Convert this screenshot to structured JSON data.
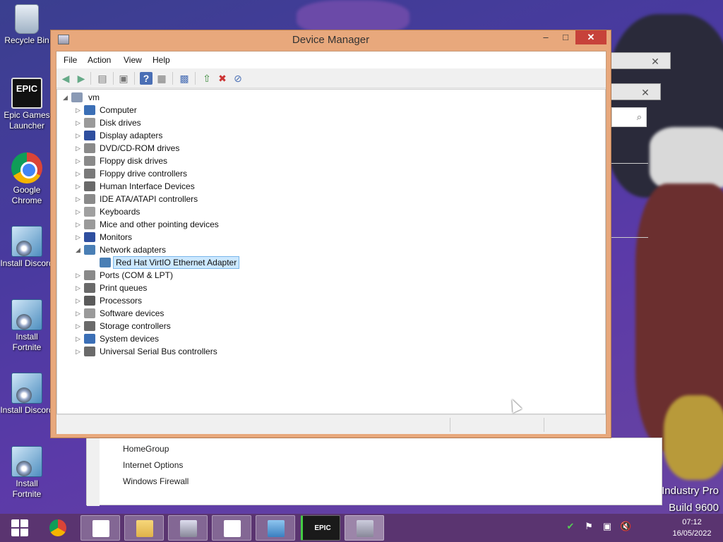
{
  "desktop": {
    "icons": [
      {
        "label": "Recycle Bin"
      },
      {
        "label": "Epic Games Launcher",
        "glyph": "EPIC"
      },
      {
        "label": "Google Chrome"
      },
      {
        "label": "Install Discord"
      },
      {
        "label": "Install Fortnite"
      },
      {
        "label": "Install Discord"
      },
      {
        "label": "Install Fortnite"
      }
    ]
  },
  "background_window": {
    "links": [
      "HomeGroup",
      "Internet Options",
      "Windows Firewall"
    ],
    "close_glyph": "✕",
    "search_glyph": "⌕"
  },
  "window": {
    "title": "Device Manager",
    "minimize_glyph": "–",
    "maximize_glyph": "□",
    "close_glyph": "✕",
    "menu": [
      "File",
      "Action",
      "View",
      "Help"
    ],
    "tree": {
      "root": "vm",
      "categories": [
        {
          "label": "Computer",
          "icon": "computer-icon",
          "color": "#3b6fb6"
        },
        {
          "label": "Disk drives",
          "icon": "disk-icon",
          "color": "#9a9a9a"
        },
        {
          "label": "Display adapters",
          "icon": "display-icon",
          "color": "#2f4f9f"
        },
        {
          "label": "DVD/CD-ROM drives",
          "icon": "dvd-icon",
          "color": "#8a8a8a"
        },
        {
          "label": "Floppy disk drives",
          "icon": "floppy-icon",
          "color": "#8a8a8a"
        },
        {
          "label": "Floppy drive controllers",
          "icon": "floppy-controller-icon",
          "color": "#7a7a7a"
        },
        {
          "label": "Human Interface Devices",
          "icon": "hid-icon",
          "color": "#6a6a6a"
        },
        {
          "label": "IDE ATA/ATAPI controllers",
          "icon": "ide-icon",
          "color": "#8a8a8a"
        },
        {
          "label": "Keyboards",
          "icon": "keyboard-icon",
          "color": "#a0a0a0"
        },
        {
          "label": "Mice and other pointing devices",
          "icon": "mouse-icon",
          "color": "#9a9a9a"
        },
        {
          "label": "Monitors",
          "icon": "monitor-icon",
          "color": "#2f4f9f"
        },
        {
          "label": "Network adapters",
          "icon": "network-icon",
          "color": "#4a7fb5",
          "expanded": true,
          "children": [
            {
              "label": "Red Hat VirtIO Ethernet Adapter",
              "icon": "network-adapter-icon",
              "color": "#4a7fb5",
              "selected": true
            }
          ]
        },
        {
          "label": "Ports (COM & LPT)",
          "icon": "port-icon",
          "color": "#8a8a8a"
        },
        {
          "label": "Print queues",
          "icon": "printer-icon",
          "color": "#6a6a6a"
        },
        {
          "label": "Processors",
          "icon": "processor-icon",
          "color": "#5a5a5a"
        },
        {
          "label": "Software devices",
          "icon": "software-device-icon",
          "color": "#9a9a9a"
        },
        {
          "label": "Storage controllers",
          "icon": "storage-controller-icon",
          "color": "#6a6a6a"
        },
        {
          "label": "System devices",
          "icon": "system-device-icon",
          "color": "#3b6fb6"
        },
        {
          "label": "Universal Serial Bus controllers",
          "icon": "usb-icon",
          "color": "#6a6a6a"
        }
      ]
    },
    "toolbar": [
      "back-icon",
      "forward-icon",
      "show-hide-console-tree-icon",
      "properties-icon",
      "help-icon",
      "action-pane-icon",
      "scan-hardware-icon",
      "update-driver-icon",
      "uninstall-icon",
      "disable-icon"
    ]
  },
  "watermark": {
    "line1": "Industry Pro",
    "line2": "Build 9600"
  },
  "taskbar": {
    "time": "07:12",
    "date": "16/05/2022",
    "epic_glyph": "EPIC"
  },
  "colors": {
    "title_bar": "#e8a87c",
    "close": "#c7423a",
    "taskbar": "#5a3470",
    "selection": "#cce8ff"
  }
}
